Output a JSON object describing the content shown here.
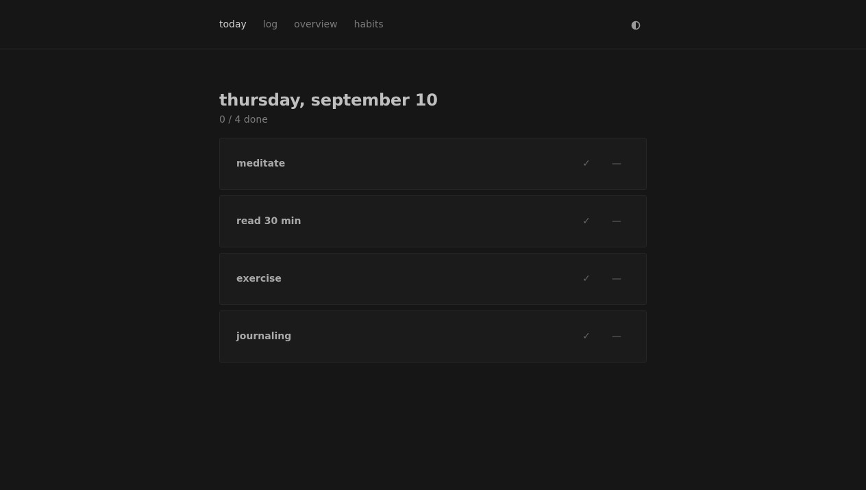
{
  "nav": {
    "items": [
      {
        "label": "today",
        "active": true
      },
      {
        "label": "log",
        "active": false
      },
      {
        "label": "overview",
        "active": false
      },
      {
        "label": "habits",
        "active": false
      }
    ],
    "theme_toggle_icon": "contrast-icon"
  },
  "main": {
    "title": "thursday, september 10",
    "progress": "0 / 4 done",
    "habits": [
      {
        "name": "meditate",
        "check_glyph": "✓",
        "skip_glyph": "—"
      },
      {
        "name": "read 30 min",
        "check_glyph": "✓",
        "skip_glyph": "—"
      },
      {
        "name": "exercise",
        "check_glyph": "✓",
        "skip_glyph": "—"
      },
      {
        "name": "journaling",
        "check_glyph": "✓",
        "skip_glyph": "—"
      }
    ]
  },
  "colors": {
    "background": "#161616",
    "card": "#1b1b1b",
    "card_border": "#262626",
    "text": "#bfbfbf",
    "muted": "#7a7a7a"
  }
}
